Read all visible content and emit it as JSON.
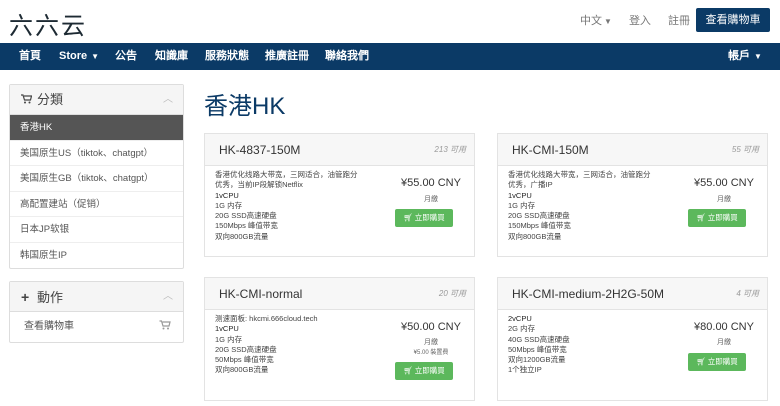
{
  "header": {
    "logo": "六六云",
    "lang": "中文",
    "login": "登入",
    "register": "註冊",
    "cart_button": "查看購物車"
  },
  "nav": {
    "items": [
      "首頁",
      "Store",
      "公告",
      "知識庫",
      "服務狀態",
      "推廣註冊",
      "聯絡我們"
    ],
    "account": "帳戶"
  },
  "sidebar": {
    "categories_title": "分類",
    "categories": [
      "香港HK",
      "美国原生US（tiktok、chatgpt）",
      "美国原生GB（tiktok、chatgpt）",
      "高配置建站（促销）",
      "日本JP软银",
      "韩国原生IP"
    ],
    "actions_title": "動作",
    "actions": [
      "查看購物車"
    ]
  },
  "page": {
    "title": "香港HK"
  },
  "products": [
    {
      "name": "HK-4837-150M",
      "qty": "213 可用",
      "desc": [
        "香港优化线路大带宽，三网适合，油管跑分",
        "优秀，当前IP段解锁Netflix",
        "1vCPU",
        "1G 内存",
        "20G SSD高速硬盘",
        "150Mbps 峰值带宽",
        "双向800GB流量"
      ],
      "price": "¥55.00 CNY",
      "cycle": "月繳",
      "setup": "",
      "buy": "立即購買"
    },
    {
      "name": "HK-CMI-150M",
      "qty": "55 可用",
      "desc": [
        "香港优化线路大带宽，三网适合，油管跑分",
        "优秀，广播IP",
        "1vCPU",
        "1G 内存",
        "20G SSD高速硬盘",
        "150Mbps 峰值带宽",
        "双向800GB流量"
      ],
      "price": "¥55.00 CNY",
      "cycle": "月繳",
      "setup": "",
      "buy": "立即購買"
    },
    {
      "name": "HK-CMI-normal",
      "qty": "20 可用",
      "desc": [
        "测速面板: hkcmi.666cloud.tech",
        "1vCPU",
        "1G 内存",
        "20G SSD高速硬盘",
        "50Mbps 峰值带宽",
        "双向800GB流量"
      ],
      "price": "¥50.00 CNY",
      "cycle": "月繳",
      "setup": "¥5.00 裝置費",
      "buy": "立即購買"
    },
    {
      "name": "HK-CMI-medium-2H2G-50M",
      "qty": "4 可用",
      "desc": [
        "2vCPU",
        "2G 内存",
        "40G SSD高速硬盘",
        "50Mbps 峰值带宽",
        "双向1200GB流量",
        "1个独立IP"
      ],
      "price": "¥80.00 CNY",
      "cycle": "月繳",
      "setup": "",
      "buy": "立即購買"
    }
  ],
  "colors": {
    "brand": "#0b3a66",
    "buy": "#5cb85c",
    "active": "#555555"
  }
}
